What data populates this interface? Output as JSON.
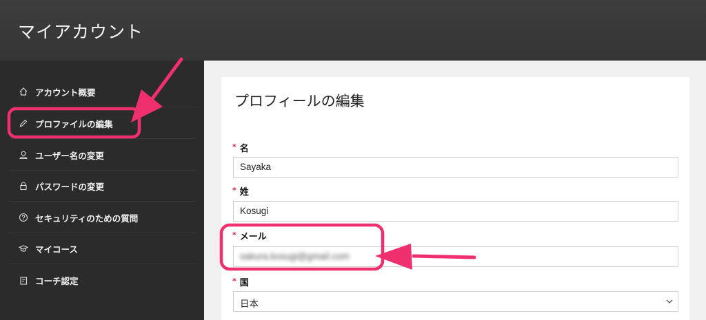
{
  "header": {
    "title": "マイアカウント"
  },
  "sidebar": {
    "items": [
      {
        "label": "アカウント概要",
        "icon": "home-icon"
      },
      {
        "label": "プロファイルの編集",
        "icon": "pencil-icon"
      },
      {
        "label": "ユーザー名の変更",
        "icon": "user-icon"
      },
      {
        "label": "パスワードの変更",
        "icon": "lock-icon"
      },
      {
        "label": "セキュリティのための質問",
        "icon": "question-circle-icon"
      },
      {
        "label": "マイコース",
        "icon": "graduation-cap-icon"
      },
      {
        "label": "コーチ認定",
        "icon": "certificate-icon"
      }
    ]
  },
  "main": {
    "title": "プロフィールの編集",
    "required_mark": "*",
    "fields": {
      "first_name": {
        "label": "名",
        "value": "Sayaka"
      },
      "last_name": {
        "label": "姓",
        "value": "Kosugi"
      },
      "email": {
        "label": "メール",
        "value": "sakura.kosugi@gmail.com"
      },
      "country": {
        "label": "国",
        "value": "日本"
      }
    }
  },
  "annotations": {
    "color": "#f0306e"
  },
  "colors": {
    "header_bg": "#3a3a3a",
    "sidebar_bg": "#2b2b2b",
    "required": "#d0203a"
  }
}
